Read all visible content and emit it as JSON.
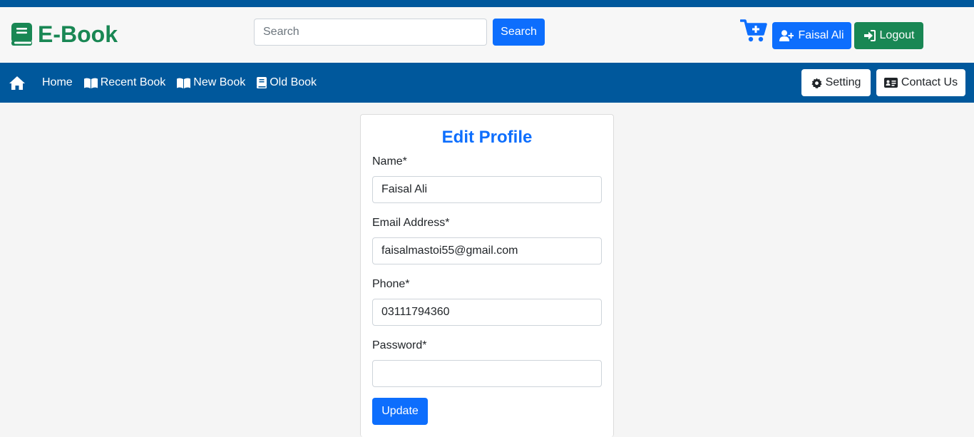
{
  "brand": {
    "name": "E-Book",
    "color": "#198754"
  },
  "header": {
    "search": {
      "placeholder": "Search",
      "value": "",
      "button_label": "Search"
    },
    "cart_icon": "cart-plus-icon",
    "user_button": {
      "label": "Faisal Ali",
      "icon": "user-plus-icon"
    },
    "logout_button": {
      "label": "Logout",
      "icon": "sign-in-icon"
    }
  },
  "navbar": {
    "background": "#00589c",
    "home_icon": "home-icon",
    "links": [
      {
        "label": "Home",
        "icon": ""
      },
      {
        "label": "Recent Book",
        "icon": "book-open-icon"
      },
      {
        "label": "New Book",
        "icon": "book-open-icon"
      },
      {
        "label": "Old Book",
        "icon": "book-icon"
      }
    ],
    "setting_button": {
      "label": "Setting",
      "icon": "gear-icon"
    },
    "contact_button": {
      "label": "Contact Us",
      "icon": "id-card-icon"
    }
  },
  "form": {
    "title": "Edit Profile",
    "fields": [
      {
        "label": "Name*",
        "value": "Faisal Ali"
      },
      {
        "label": "Email Address*",
        "value": "faisalmastoi55@gmail.com"
      },
      {
        "label": "Phone*",
        "value": "03111794360"
      },
      {
        "label": "Password*",
        "value": ""
      }
    ],
    "submit_label": "Update"
  },
  "colors": {
    "primary": "#0d6efd",
    "success": "#198754",
    "nav": "#00589c"
  }
}
